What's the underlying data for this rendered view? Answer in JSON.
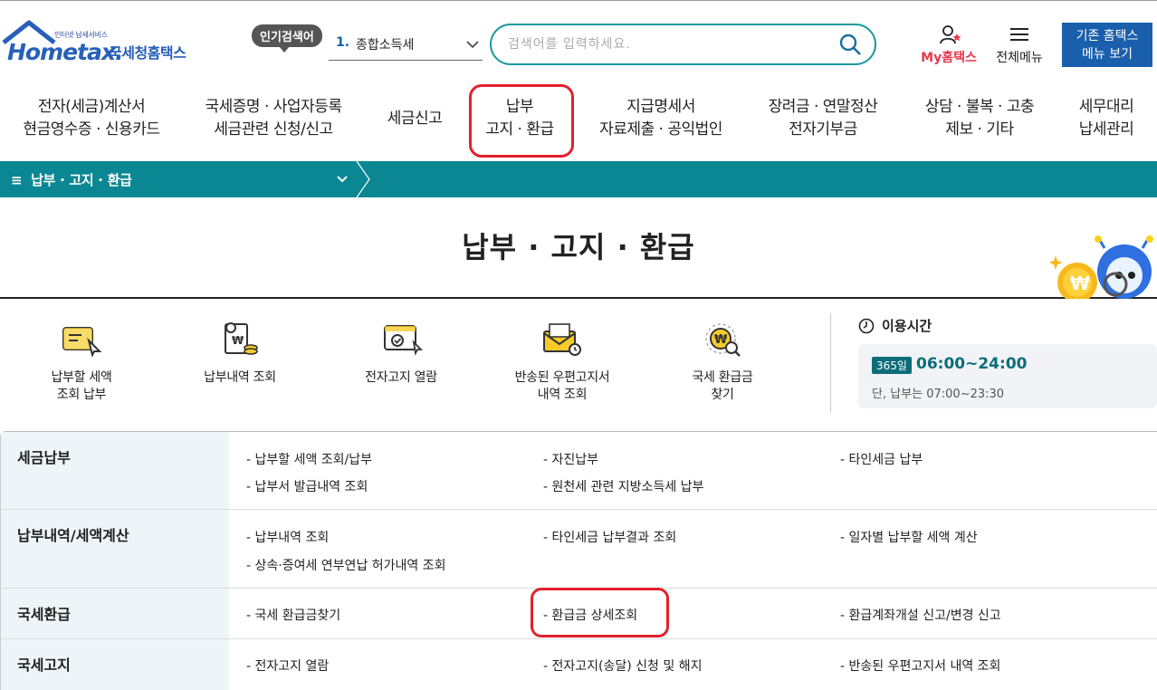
{
  "header": {
    "logo_small": "인터넷 납세서비스",
    "logo_brand": "Hometax.",
    "logo_kor": "국세청홈택스",
    "popular_label": "인기검색어",
    "popular_rank": "1.",
    "popular_keyword": "종합소득세",
    "search_placeholder": "검색어를 입력하세요.",
    "my_home": "My홈택스",
    "all_menu": "전체메뉴",
    "old_home_line1": "기존 홈택스",
    "old_home_line2": "메뉴 보기"
  },
  "gnb": [
    {
      "line1": "전자(세금)계산서",
      "line2": "현금영수증 · 신용카드"
    },
    {
      "line1": "국세증명 · 사업자등록",
      "line2": "세금관련 신청/신고"
    },
    {
      "line1": "세금신고",
      "line2": ""
    },
    {
      "line1": "납부",
      "line2": "고지 · 환급"
    },
    {
      "line1": "지급명세서",
      "line2": "자료제출 · 공익법인"
    },
    {
      "line1": "장려금 · 연말정산",
      "line2": "전자기부금"
    },
    {
      "line1": "상담 · 불복 · 고충",
      "line2": "제보 · 기타"
    },
    {
      "line1": "세무대리",
      "line2": "납세관리"
    }
  ],
  "breadcrumb": {
    "menu_icon": "≡",
    "label": "납부 · 고지 · 환급"
  },
  "page_title": "납부 · 고지 · 환급",
  "quick_menu": [
    {
      "line1": "납부할 세액",
      "line2": "조회 납부"
    },
    {
      "line1": "납부내역 조회",
      "line2": ""
    },
    {
      "line1": "전자고지 열람",
      "line2": ""
    },
    {
      "line1": "반송된 우편고지서",
      "line2": "내역 조회"
    },
    {
      "line1": "국세 환급금",
      "line2": "찾기"
    }
  ],
  "hours": {
    "title": "이용시간",
    "badge": "365일",
    "time": "06:00~24:00",
    "note": "단, 납부는 07:00~23:30"
  },
  "categories": [
    {
      "name": "세금납부",
      "links": [
        "- 납부할 세액 조회/납부",
        "- 자진납부",
        "- 타인세금 납부",
        "- 납부서 발급내역 조회",
        "- 원천세 관련 지방소득세 납부"
      ]
    },
    {
      "name": "납부내역/세액계산",
      "links": [
        "- 납부내역 조회",
        "- 타인세금 납부결과 조회",
        "- 일자별 납부할 세액 계산",
        "- 상속·증여세 연부연납 허가내역 조회"
      ]
    },
    {
      "name": "국세환급",
      "links": [
        "- 국세 환급금찾기",
        "- 환급금 상세조회",
        "- 환급계좌개설 신고/변경 신고"
      ]
    },
    {
      "name": "국세고지",
      "links": [
        "- 전자고지 열람",
        "- 전자고지(송달) 신청 및 해지",
        "- 반송된 우편고지서 내역 조회"
      ]
    }
  ],
  "colors": {
    "teal": "#0b8793",
    "blue": "#1a5fab",
    "highlight": "#e3202c",
    "pink": "#e8374d"
  }
}
